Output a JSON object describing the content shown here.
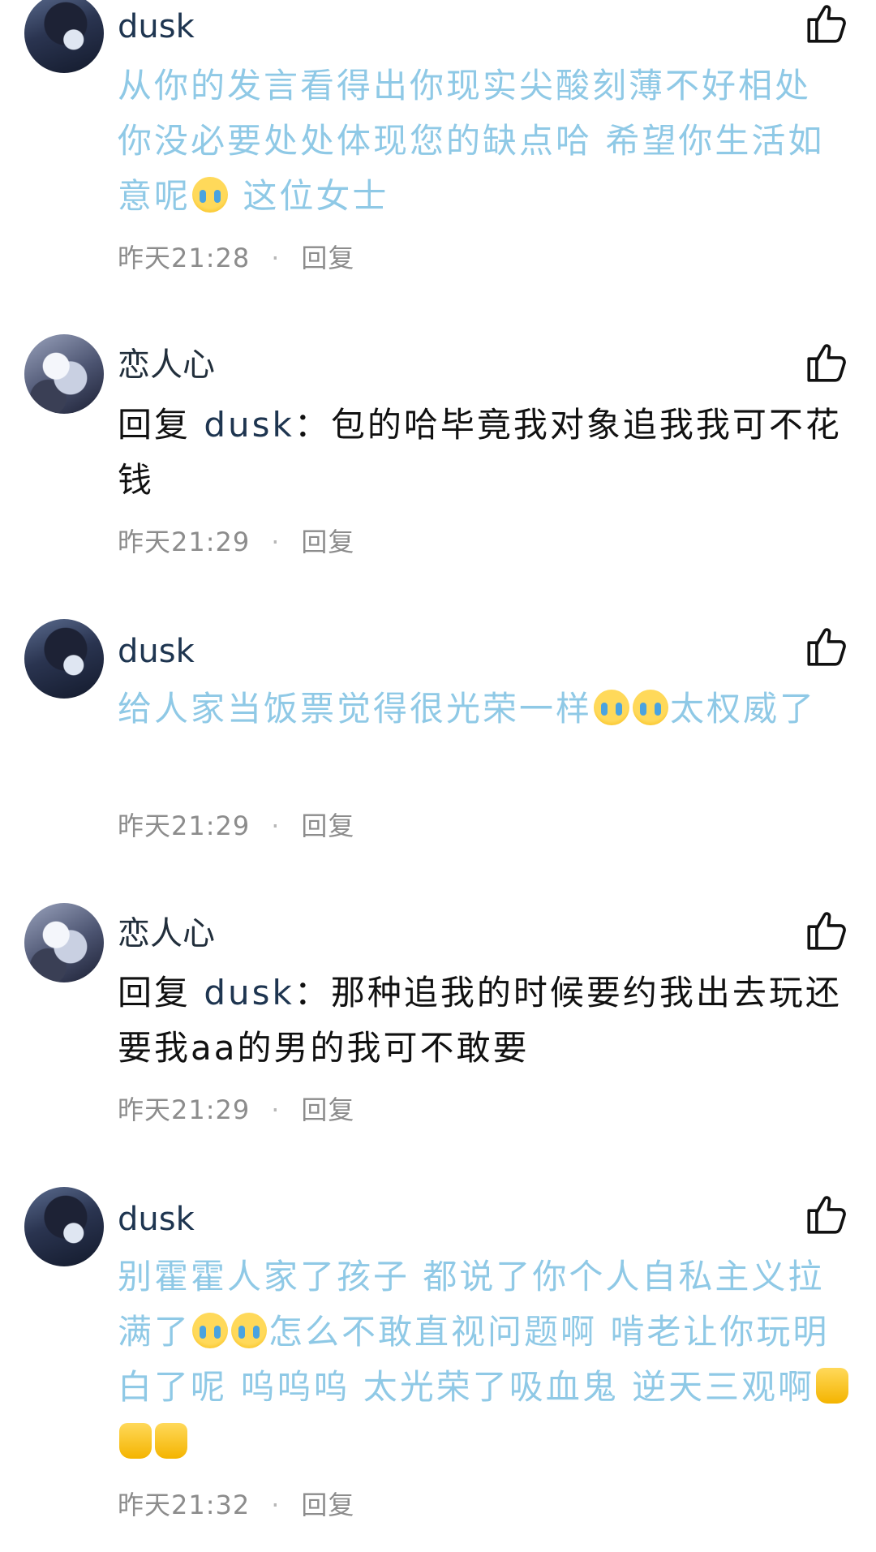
{
  "comments": [
    {
      "user": "dusk",
      "text_parts": [
        "从你的发言看得出你现实尖酸刻薄不好相处 你没必要处处体现您的缺点哈 希望你生活如意呢",
        " 这位女士"
      ],
      "time": "昨天21:28",
      "reply_label": "回复"
    },
    {
      "user": "恋人心",
      "reply_prefix": "回复",
      "reply_to": "dusk",
      "text": "：包的哈毕竟我对象追我我可不花钱",
      "time": "昨天21:29",
      "reply_label": "回复"
    },
    {
      "user": "dusk",
      "text_parts": [
        "给人家当饭票觉得很光荣一样",
        "太权威了"
      ],
      "time": "昨天21:29",
      "reply_label": "回复"
    },
    {
      "user": "恋人心",
      "reply_prefix": "回复",
      "reply_to": "dusk",
      "text": "：那种追我的时候要约我出去玩还要我aa的男的我可不敢要",
      "time": "昨天21:29",
      "reply_label": "回复"
    },
    {
      "user": "dusk",
      "text_parts": [
        "别霍霍人家了孩子 都说了你个人自私主义拉满了",
        "怎么不敢直视问题啊 啃老让你玩明白了呢 呜呜呜 太光荣了吸血鬼 逆天三观啊"
      ],
      "time": "昨天21:32",
      "reply_label": "回复"
    }
  ],
  "icons": {
    "like": "thumbs-up-outline-icon",
    "cry_emoji": "loudly-crying-face-emoji",
    "thumb_emoji": "thumbs-up-emoji"
  },
  "colors": {
    "blue_text": "#8fc9e6",
    "username": "#1e3550",
    "meta": "#8c8c8c"
  }
}
